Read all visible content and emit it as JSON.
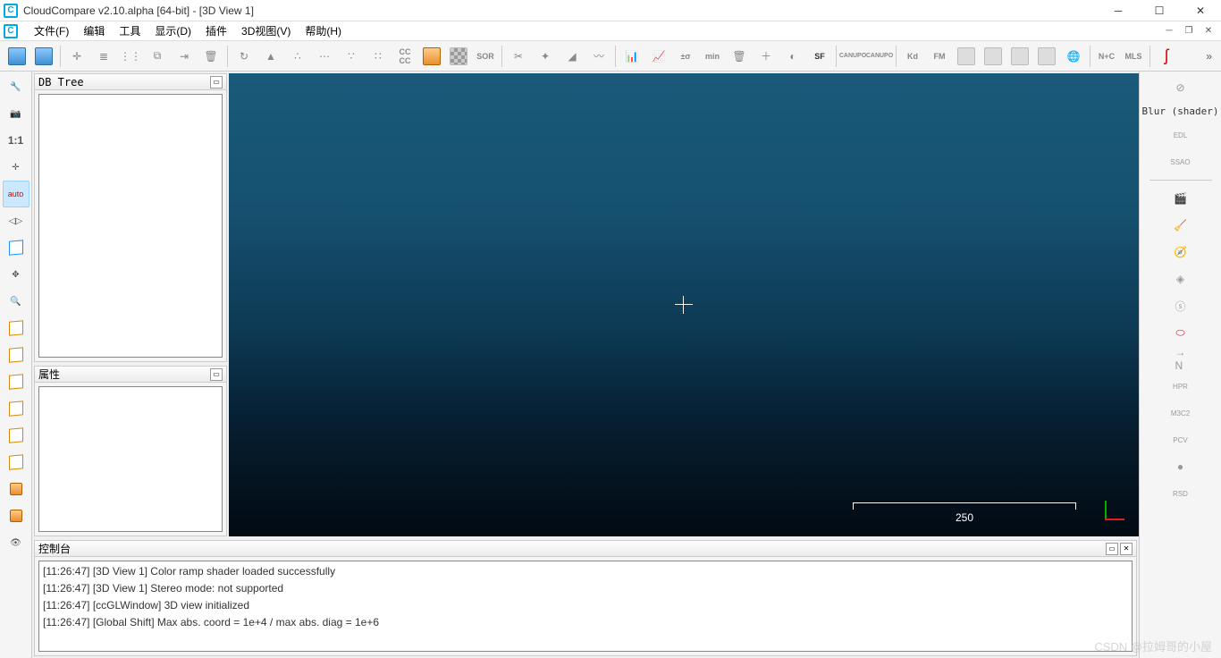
{
  "window": {
    "title": "CloudCompare v2.10.alpha [64-bit] - [3D View 1]"
  },
  "menu": {
    "items": [
      {
        "id": "file",
        "label": "文件(F)"
      },
      {
        "id": "edit",
        "label": "编辑"
      },
      {
        "id": "tools",
        "label": "工具"
      },
      {
        "id": "display",
        "label": "显示(D)"
      },
      {
        "id": "plugins",
        "label": "插件"
      },
      {
        "id": "view3d",
        "label": "3D视图(V)"
      },
      {
        "id": "help",
        "label": "帮助(H)"
      }
    ]
  },
  "toolbar": {
    "sor_label": "SOR",
    "sf_label": "SF",
    "kd_label": "Kd",
    "fm_label": "FM",
    "nc_label": "N+C",
    "mls_label": "MLS"
  },
  "panels": {
    "dbtree": {
      "title": "DB Tree"
    },
    "properties": {
      "title": "属性"
    },
    "console": {
      "title": "控制台"
    }
  },
  "left_tools": {
    "one_to_one": "1:1",
    "auto": "auto",
    "front": "FRONT",
    "back": "BACK",
    "normal_label": "N"
  },
  "right_panel": {
    "blur_label": "Blur (shader)",
    "edl_label": "EDL",
    "ssao_label": "SSAO",
    "hpr_label": "HPR",
    "m3c2_label": "M3C2",
    "pcv_label": "PCV",
    "rsd_label": "RSD"
  },
  "viewport": {
    "scale_value": "250",
    "crosshair": true
  },
  "console": {
    "lines": [
      "[11:26:47] [3D View 1] Color ramp shader loaded successfully",
      "[11:26:47] [3D View 1] Stereo mode: not supported",
      "[11:26:47] [ccGLWindow] 3D view initialized",
      "[11:26:47] [Global Shift] Max abs. coord = 1e+4 / max abs. diag = 1e+6"
    ]
  },
  "watermark": "CSDN @拉姆哥的小屋"
}
